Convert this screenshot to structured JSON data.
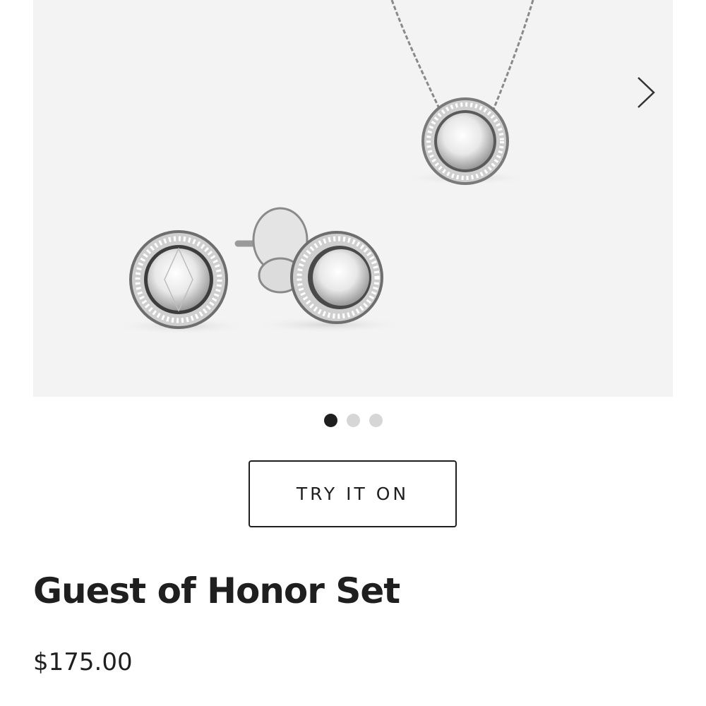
{
  "carousel": {
    "image_icon": "earrings-necklace-product-image",
    "next_icon": "chevron-right-icon",
    "dots_count": 3,
    "active_dot": 0
  },
  "actions": {
    "try_on_label": "TRY IT ON"
  },
  "product": {
    "title": "Guest of Honor Set",
    "price": "$175.00"
  },
  "colors": {
    "background": "#ffffff",
    "image_bg": "#f3f3f3",
    "text": "#1f1f1f",
    "dot_active": "#1f1f1f",
    "dot_inactive": "#d6d6d6"
  }
}
